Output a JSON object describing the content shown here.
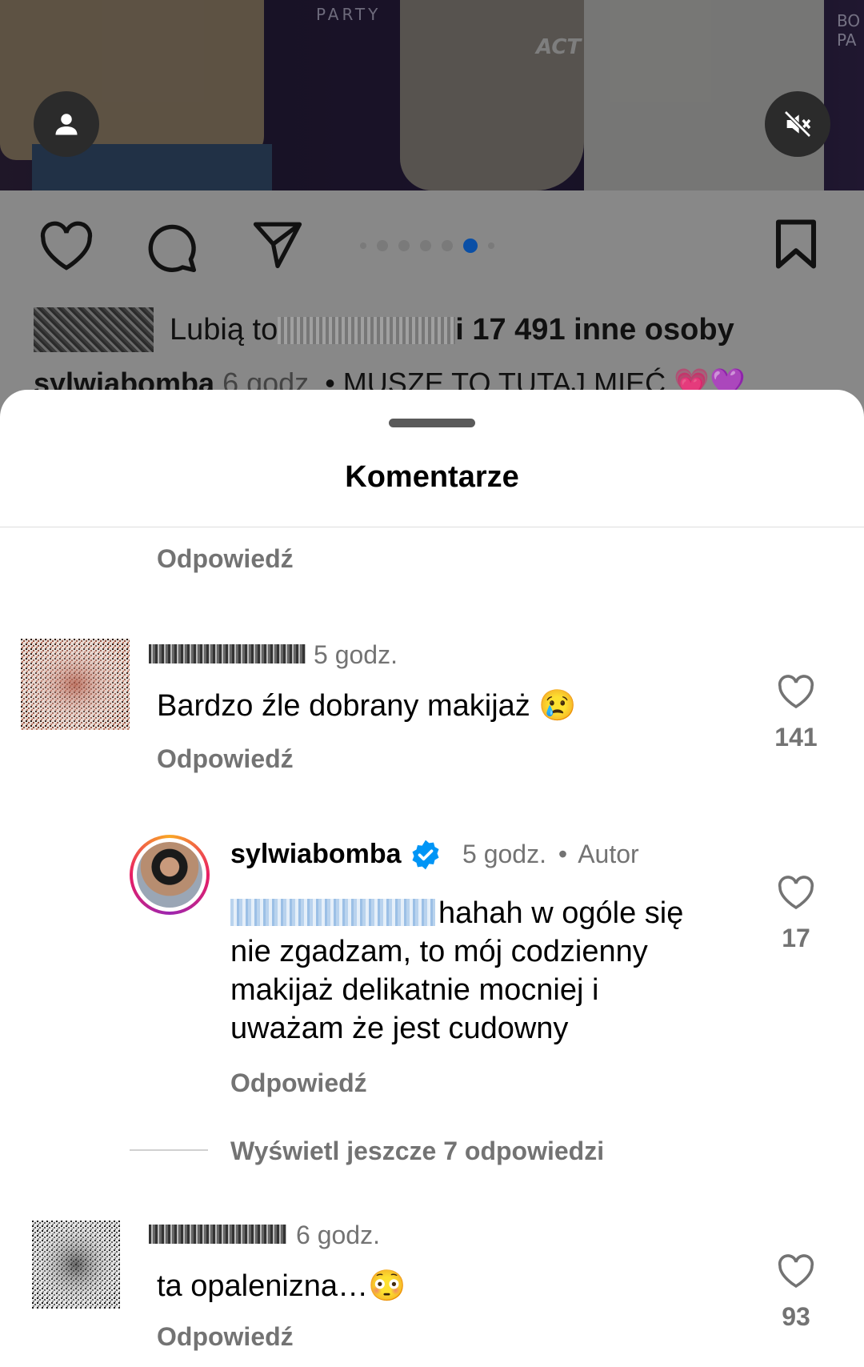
{
  "post": {
    "photo_signs": [
      "PARTY",
      "ACT",
      "BO\nPA"
    ],
    "likes": {
      "prefix": "Lubią to",
      "suffix": "i 17 491 inne osoby"
    },
    "caption": {
      "username": "sylwiabomba",
      "time": "6 godz.",
      "text": "• MUSZĘ TO TUTAJ MIEĆ 💗💜"
    },
    "icons": [
      "user-tag-icon",
      "mute-icon",
      "heart-icon",
      "comment-icon",
      "share-icon",
      "bookmark-icon"
    ],
    "carousel": {
      "count": 6,
      "active_index": 5
    }
  },
  "sheet": {
    "title": "Komentarze",
    "top_reply": "Odpowiedź",
    "comments": [
      {
        "time": "5 godz.",
        "text": "Bardzo źle dobrany makijaż 😢",
        "reply": "Odpowiedź",
        "likes": "141"
      },
      {
        "time": "6 godz.",
        "text": "ta opalenizna…😳",
        "reply": "Odpowiedź",
        "likes": "93"
      }
    ],
    "author_reply": {
      "username": "sylwiabomba",
      "time": "5 godz.",
      "separator": "•",
      "badge": "Autor",
      "lines": [
        "hahah w ogóle się",
        "nie zgadzam, to mój codzienny",
        "makijaż delikatnie mocniej i",
        "uważam że jest cudowny"
      ],
      "reply": "Odpowiedź",
      "likes": "17"
    },
    "view_more": "Wyświetl jeszcze 7 odpowiedzi"
  },
  "colors": {
    "accent_blue": "#0095f6",
    "muted_text": "#737373",
    "carousel_active": "#0a4fa6"
  }
}
